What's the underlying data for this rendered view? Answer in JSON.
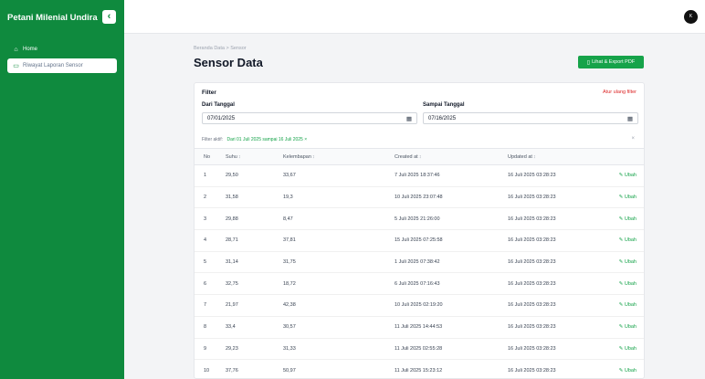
{
  "sidebar": {
    "brand": "Petani Milenial Undira",
    "collapse_icon": "chevron-left-icon",
    "collapse_glyph": "‹",
    "items": [
      {
        "label": "Home",
        "icon": "home-icon",
        "glyph": "⌂"
      },
      {
        "label": "Riwayat Laporan Sensor",
        "icon": "folder-icon",
        "glyph": "▭"
      }
    ]
  },
  "header": {
    "avatar": "K"
  },
  "breadcrumb": "Beranda Data > Sensor",
  "page_title": "Sensor Data",
  "export_button": {
    "label": "Lihat & Export PDF",
    "glyph": "▯"
  },
  "filter": {
    "title": "Filter",
    "reset": "Atur ulang filter",
    "from_label": "Dari Tanggal",
    "from_value": "07/01/2025",
    "to_label": "Sampai Tanggal",
    "to_value": "07/16/2025",
    "calendar_glyph": "▦",
    "active_label": "Filter aktif:",
    "active_tag": "Dari 01 Juli 2025 sampai 16 Juli 2025 ×",
    "clear_glyph": "×"
  },
  "table": {
    "columns": [
      "No",
      "Suhu",
      "Kelembapan",
      "Created at",
      "Updated at",
      ""
    ],
    "sort_glyph": "↕",
    "rows": [
      {
        "no": "1",
        "suhu": "29,50",
        "kelembapan": "33,67",
        "created": "7 Juli 2025 18:37:46",
        "updated": "16 Juli 2025 03:28:23",
        "action": "Ubah"
      },
      {
        "no": "2",
        "suhu": "31,58",
        "kelembapan": "19,3",
        "created": "10 Juli 2025 23:07:48",
        "updated": "16 Juli 2025 03:28:23",
        "action": "Ubah"
      },
      {
        "no": "3",
        "suhu": "29,88",
        "kelembapan": "8,47",
        "created": "5 Juli 2025 21:26:00",
        "updated": "16 Juli 2025 03:28:23",
        "action": "Ubah"
      },
      {
        "no": "4",
        "suhu": "28,71",
        "kelembapan": "37,81",
        "created": "15 Juli 2025 07:25:58",
        "updated": "16 Juli 2025 03:28:23",
        "action": "Ubah"
      },
      {
        "no": "5",
        "suhu": "31,14",
        "kelembapan": "31,75",
        "created": "1 Juli 2025 07:38:42",
        "updated": "16 Juli 2025 03:28:23",
        "action": "Ubah"
      },
      {
        "no": "6",
        "suhu": "32,75",
        "kelembapan": "18,72",
        "created": "6 Juli 2025 07:16:43",
        "updated": "16 Juli 2025 03:28:23",
        "action": "Ubah"
      },
      {
        "no": "7",
        "suhu": "21,97",
        "kelembapan": "42,38",
        "created": "10 Juli 2025 02:19:20",
        "updated": "16 Juli 2025 03:28:23",
        "action": "Ubah"
      },
      {
        "no": "8",
        "suhu": "33,4",
        "kelembapan": "30,57",
        "created": "11 Juli 2025 14:44:53",
        "updated": "16 Juli 2025 03:28:23",
        "action": "Ubah"
      },
      {
        "no": "9",
        "suhu": "29,23",
        "kelembapan": "31,33",
        "created": "11 Juli 2025 02:55:28",
        "updated": "16 Juli 2025 03:28:23",
        "action": "Ubah"
      },
      {
        "no": "10",
        "suhu": "37,76",
        "kelembapan": "50,97",
        "created": "11 Juli 2025 15:23:12",
        "updated": "16 Juli 2025 03:28:23",
        "action": "Ubah"
      }
    ]
  },
  "colors": {
    "brand_green": "#0f8a3e",
    "accent_green": "#16a34a",
    "danger": "#dc2626"
  }
}
